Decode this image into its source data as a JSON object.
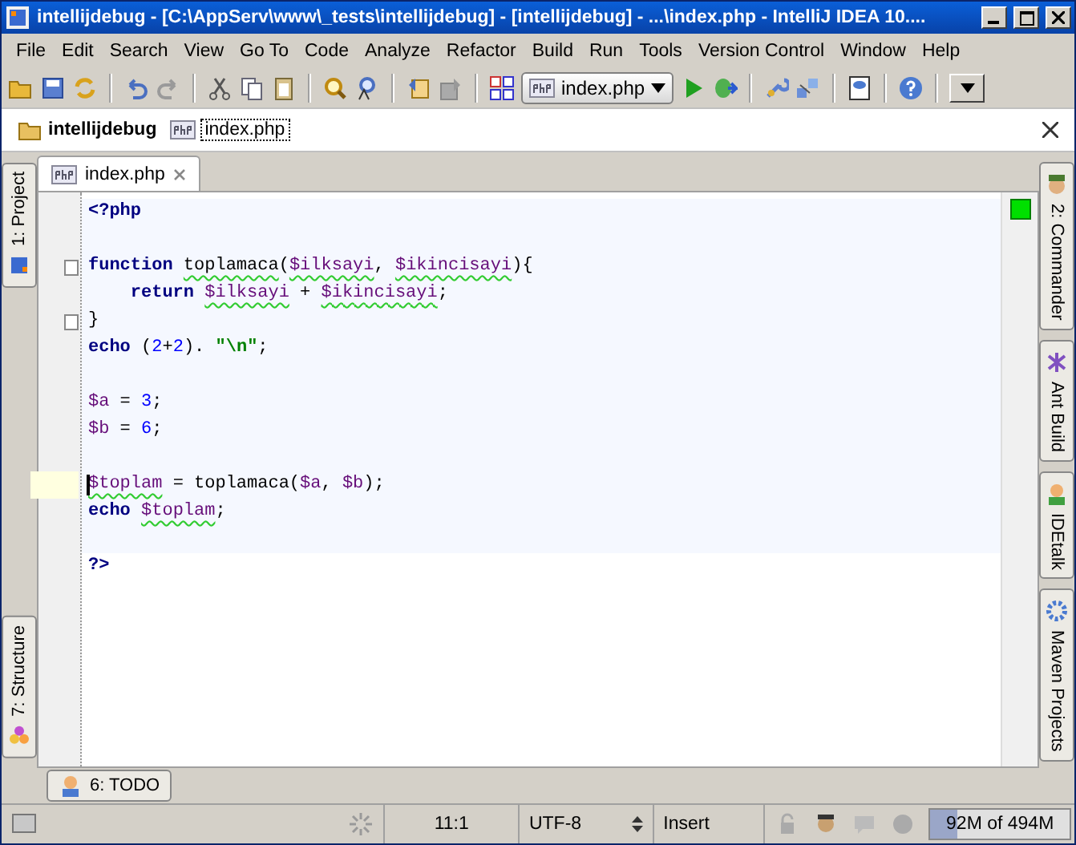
{
  "window": {
    "title": "intellijdebug - [C:\\AppServ\\www\\_tests\\intellijdebug] - [intellijdebug] - ...\\index.php - IntelliJ IDEA 10...."
  },
  "menu": [
    "File",
    "Edit",
    "Search",
    "View",
    "Go To",
    "Code",
    "Analyze",
    "Refactor",
    "Build",
    "Run",
    "Tools",
    "Version Control",
    "Window",
    "Help"
  ],
  "toolbar": {
    "run_config": "index.php"
  },
  "breadcrumbs": [
    {
      "label": "intellijdebug",
      "kind": "folder"
    },
    {
      "label": "index.php",
      "kind": "file"
    }
  ],
  "editor_tabs": [
    {
      "label": "index.php",
      "selected": true
    }
  ],
  "left_tools_top": [
    {
      "label": "1: Project"
    }
  ],
  "left_tools_bottom": [
    {
      "label": "7: Structure"
    }
  ],
  "right_tools": [
    {
      "label": "2: Commander"
    },
    {
      "label": "Ant Build"
    },
    {
      "label": "IDEtalk"
    },
    {
      "label": "Maven Projects"
    }
  ],
  "code_blocks": [
    {
      "lines": [
        {
          "tokens": [
            {
              "text": "<?php",
              "kind": "keyword"
            }
          ]
        }
      ]
    },
    {
      "lines": [
        {
          "fold": true,
          "tokens": [
            {
              "text": "function ",
              "kind": "keyword"
            },
            {
              "text": "toplamaca",
              "kind": "plain",
              "warn": true
            },
            {
              "text": "(",
              "kind": "plain"
            },
            {
              "text": "$ilksayi",
              "kind": "var",
              "warn": true
            },
            {
              "text": ", ",
              "kind": "plain"
            },
            {
              "text": "$ikincisayi",
              "kind": "var",
              "warn": true
            },
            {
              "text": "){",
              "kind": "plain"
            }
          ]
        },
        {
          "tokens": [
            {
              "text": "    return ",
              "kind": "keyword"
            },
            {
              "text": "$ilksayi",
              "kind": "var",
              "warn": true
            },
            {
              "text": " + ",
              "kind": "plain"
            },
            {
              "text": "$ikincisayi",
              "kind": "var",
              "warn": true
            },
            {
              "text": ";",
              "kind": "plain"
            }
          ]
        },
        {
          "fold": true,
          "tokens": [
            {
              "text": "}",
              "kind": "plain"
            }
          ]
        },
        {
          "tokens": [
            {
              "text": "echo ",
              "kind": "keyword"
            },
            {
              "text": "(",
              "kind": "plain"
            },
            {
              "text": "2",
              "kind": "number"
            },
            {
              "text": "+",
              "kind": "plain"
            },
            {
              "text": "2",
              "kind": "number"
            },
            {
              "text": "). ",
              "kind": "plain"
            },
            {
              "text": "\"\\n\"",
              "kind": "string"
            },
            {
              "text": ";",
              "kind": "plain"
            }
          ]
        }
      ]
    },
    {
      "lines": [
        {
          "tokens": [
            {
              "text": "$a",
              "kind": "var"
            },
            {
              "text": " = ",
              "kind": "plain"
            },
            {
              "text": "3",
              "kind": "number"
            },
            {
              "text": ";",
              "kind": "plain"
            }
          ]
        },
        {
          "tokens": [
            {
              "text": "$b",
              "kind": "var"
            },
            {
              "text": " = ",
              "kind": "plain"
            },
            {
              "text": "6",
              "kind": "number"
            },
            {
              "text": ";",
              "kind": "plain"
            }
          ]
        }
      ]
    },
    {
      "lines": [
        {
          "current": true,
          "tokens": [
            {
              "text": "$toplam",
              "kind": "var",
              "warn": true
            },
            {
              "text": " = toplamaca(",
              "kind": "plain"
            },
            {
              "text": "$a",
              "kind": "var"
            },
            {
              "text": ", ",
              "kind": "plain"
            },
            {
              "text": "$b",
              "kind": "var"
            },
            {
              "text": ");",
              "kind": "plain"
            }
          ]
        },
        {
          "tokens": [
            {
              "text": "echo ",
              "kind": "keyword"
            },
            {
              "text": "$toplam",
              "kind": "var",
              "warn": true
            },
            {
              "text": ";",
              "kind": "plain"
            }
          ]
        }
      ]
    },
    {
      "lines": [
        {
          "tokens": [
            {
              "text": "?>",
              "kind": "keyword"
            }
          ]
        }
      ]
    }
  ],
  "bottom_tools": [
    {
      "label": "6: TODO"
    }
  ],
  "status_bar": {
    "position": "11:1",
    "encoding": "UTF-8",
    "mode": "Insert",
    "memory": "92M of 494M",
    "level": 0.19
  }
}
